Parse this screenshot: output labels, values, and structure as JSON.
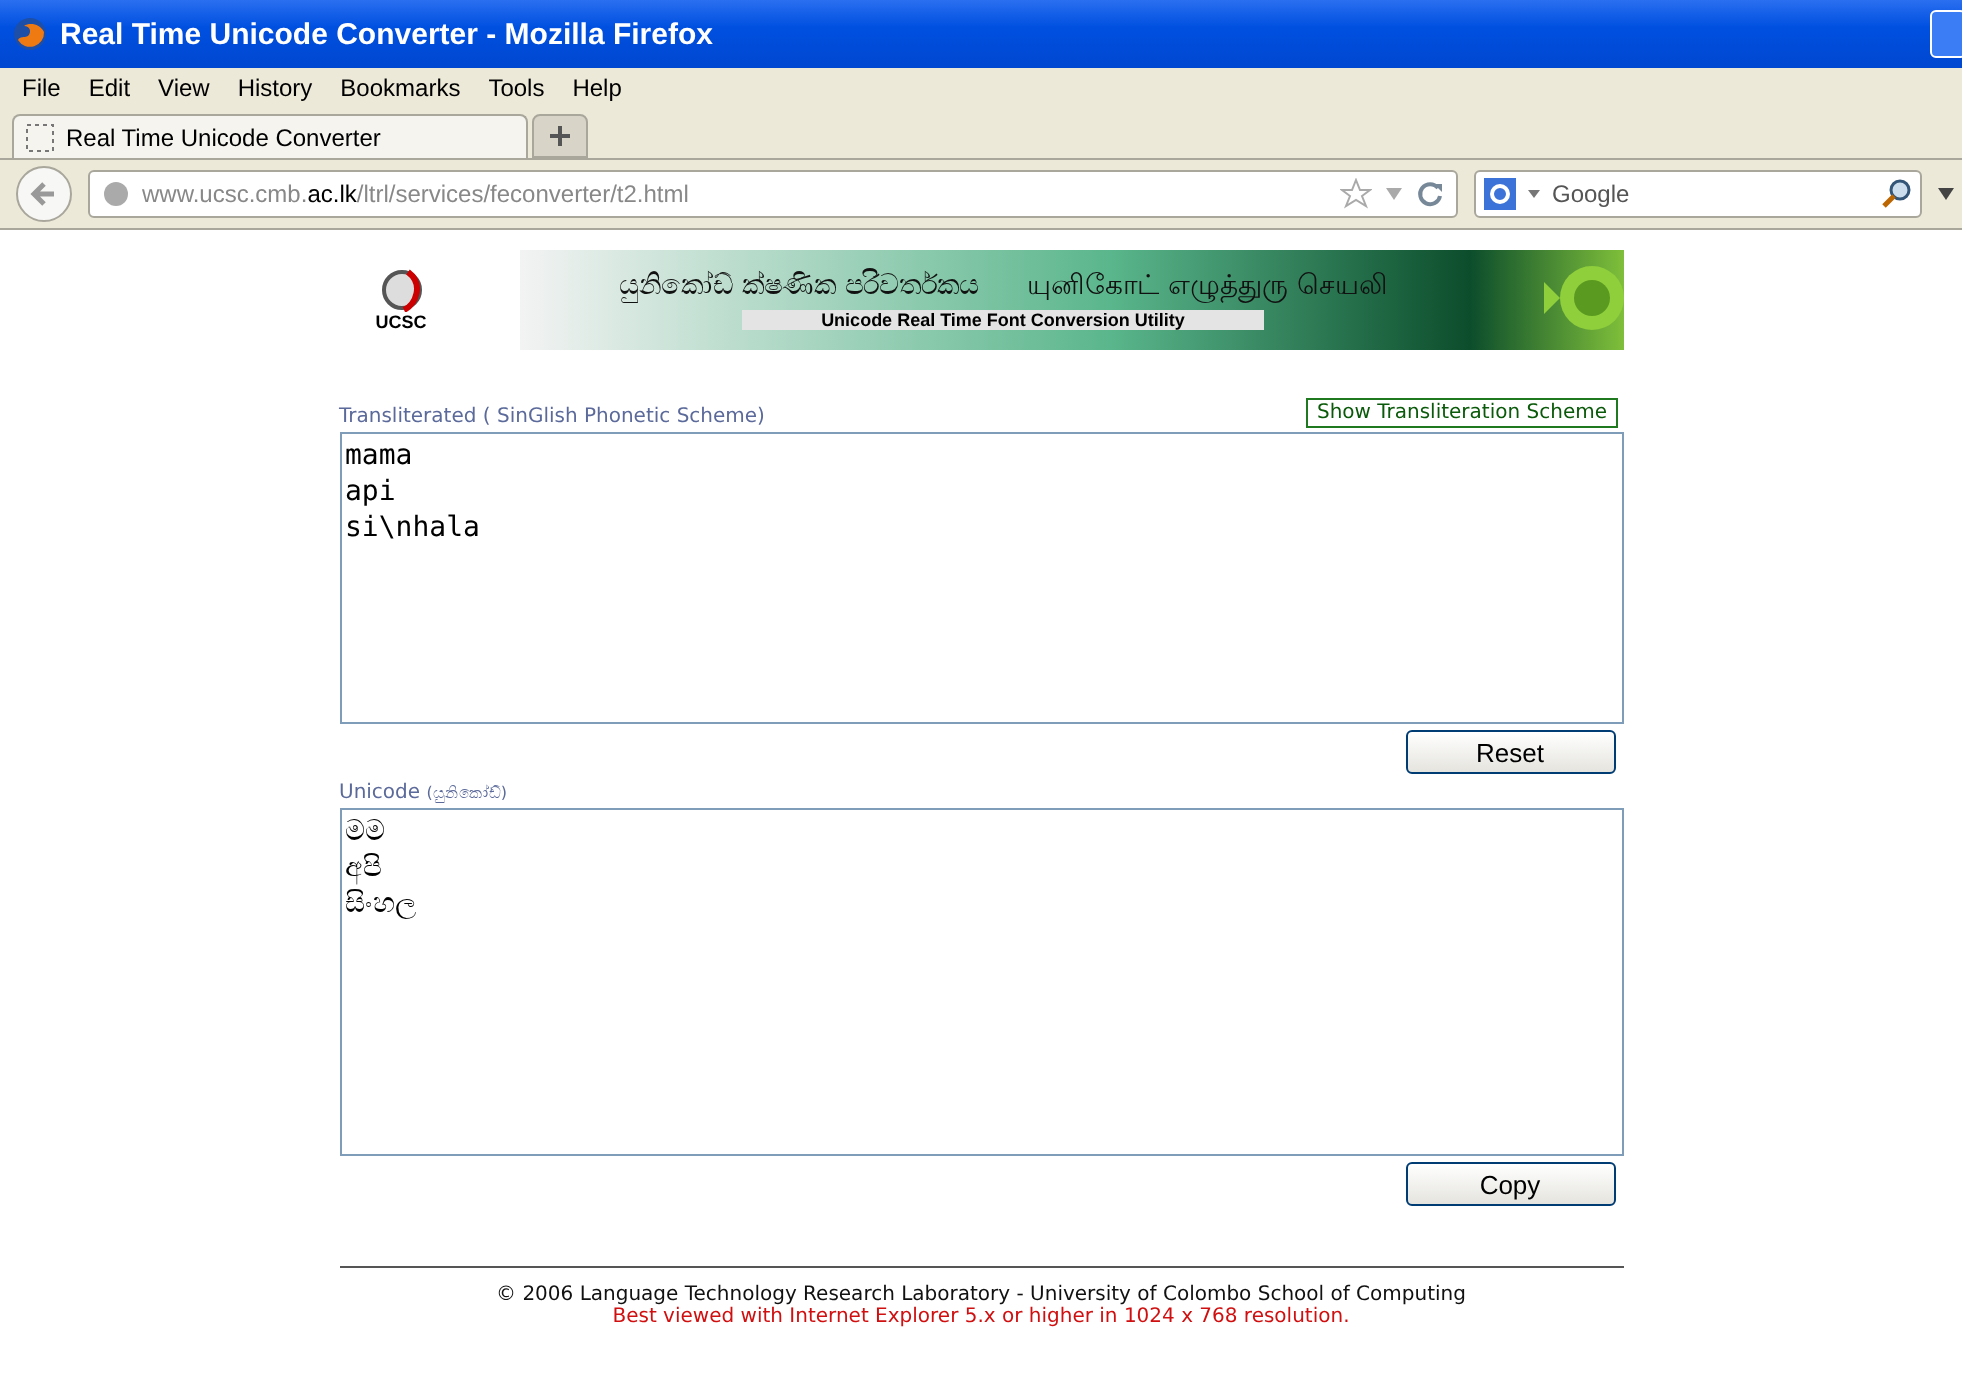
{
  "window": {
    "title": "Real Time Unicode Converter - Mozilla Firefox"
  },
  "menu": [
    "File",
    "Edit",
    "View",
    "History",
    "Bookmarks",
    "Tools",
    "Help"
  ],
  "tabs": [
    {
      "label": "Real Time Unicode Converter",
      "selected": true
    }
  ],
  "address_bar": {
    "prefix": "www.ucsc.cmb.",
    "domain": "ac.lk",
    "path": "/ltrl/services/feconverter/t2.html"
  },
  "search": {
    "placeholder": "Google"
  },
  "banner": {
    "logo_text": "UCSC",
    "sinhala_title": "යුනිකෝඩ් ක්ෂණික පරිවර්තකය",
    "tamil_title": "யுனிகோட் எழுத்துரு செயலி",
    "subtitle": "Unicode Real Time Font Conversion Utility"
  },
  "input_section": {
    "label": "Transliterated ( SinGlish Phonetic Scheme)",
    "scheme_button": "Show Transliteration Scheme",
    "lines": [
      "mama",
      "api",
      "si\\nhala"
    ],
    "button": "Reset"
  },
  "output_section": {
    "label": "Unicode",
    "label_note": "(යුනිකෝඩ්)",
    "lines": [
      "මම",
      "අපි",
      "සිංහල"
    ],
    "button": "Copy"
  },
  "footer": {
    "copyright": "© 2006 Language Technology Research Laboratory - University of Colombo School of Computing",
    "note": "Best viewed with Internet Explorer 5.x or higher in 1024 x 768 resolution."
  }
}
